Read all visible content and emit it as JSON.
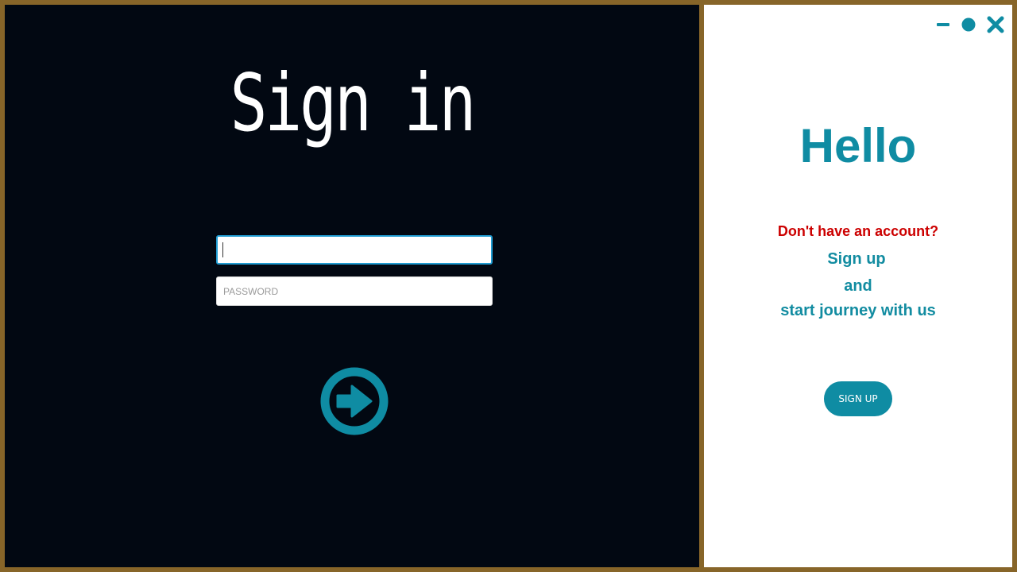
{
  "sign_in": {
    "title": "Sign in",
    "username": {
      "value": "",
      "placeholder": ""
    },
    "password": {
      "value": "",
      "placeholder": "PASSWORD"
    },
    "submit_icon": "arrow-right-circle-icon"
  },
  "window_controls": {
    "minimize_icon": "minimize-icon",
    "maximize_icon": "circle-icon",
    "close_icon": "close-icon"
  },
  "side": {
    "greeting": "Hello",
    "question": "Don't have an account?",
    "line1": "Sign up",
    "line2": "and",
    "line3": "start journey with us",
    "button_label": "SIGN UP"
  },
  "colors": {
    "accent": "#0f8ca3",
    "frame": "#876529",
    "dark_panel": "#020812",
    "warning_text": "#cc0000"
  }
}
